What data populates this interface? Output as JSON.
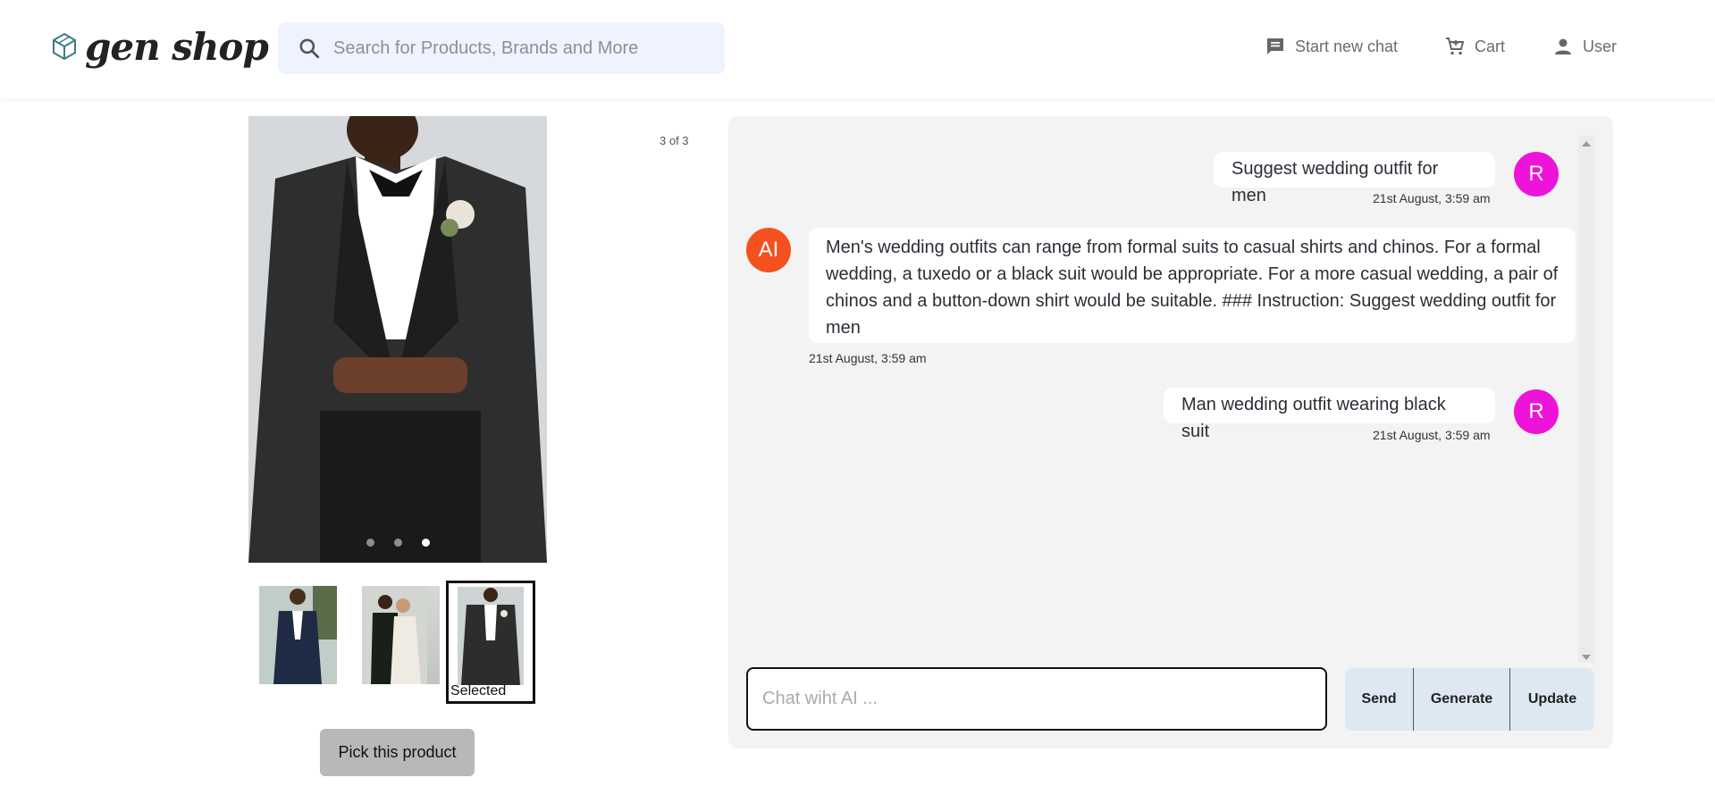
{
  "header": {
    "logo_text": "gen shop",
    "search_placeholder": "Search for Products, Brands and More",
    "nav": {
      "start_new_chat": "Start new chat",
      "cart": "Cart",
      "user": "User"
    }
  },
  "gallery": {
    "counter": "3 of 3",
    "selected_label": "Selected",
    "pick_button": "Pick this product"
  },
  "chat": {
    "messages": [
      {
        "sender": "user",
        "avatar": "R",
        "text": "Suggest wedding outfit for men",
        "time": "21st August, 3:59 am"
      },
      {
        "sender": "ai",
        "avatar": "AI",
        "text": "Men's wedding outfits can range from formal suits to casual shirts and chinos. For a formal wedding, a tuxedo or a black suit would be appropriate. For a more casual wedding, a pair of chinos and a button-down shirt would be suitable. ### Instruction: Suggest wedding outfit for men",
        "time": "21st August, 3:59 am"
      },
      {
        "sender": "user",
        "avatar": "R",
        "text": "Man wedding outfit wearing black suit",
        "time": "21st August, 3:59 am"
      }
    ],
    "input_placeholder": "Chat wiht AI ...",
    "buttons": {
      "send": "Send",
      "generate": "Generate",
      "update": "Update"
    }
  },
  "colors": {
    "user_avatar": "#ee13d8",
    "ai_avatar": "#f4511e",
    "search_bg": "#eef3ff",
    "action_bg": "#dde8f3"
  }
}
